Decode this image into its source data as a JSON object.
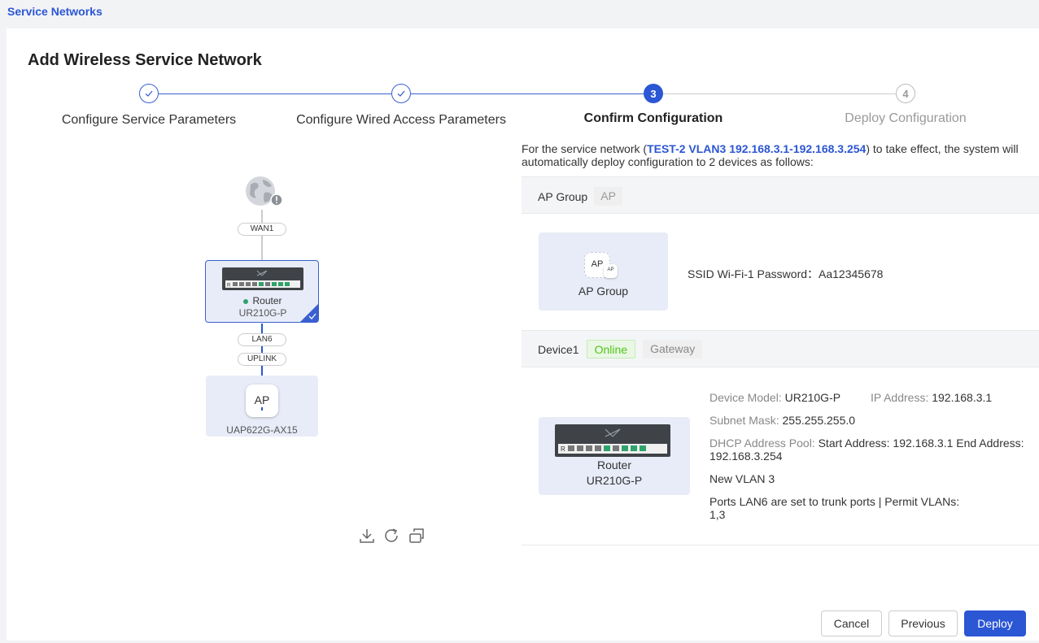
{
  "breadcrumb": "Service Networks",
  "title": "Add Wireless Service Network",
  "steps": [
    {
      "label": "Configure Service Parameters",
      "state": "done"
    },
    {
      "label": "Configure Wired Access Parameters",
      "state": "done"
    },
    {
      "label": "Confirm Configuration",
      "state": "current",
      "number": "3"
    },
    {
      "label": "Deploy Configuration",
      "state": "future",
      "number": "4"
    }
  ],
  "topology": {
    "wan_tag": "WAN1",
    "router_label": "Router",
    "router_model": "UR210G-P",
    "lan_tag": "LAN6",
    "uplink_tag": "UPLINK",
    "ap_icon_text": "AP",
    "ap_model": "UAP622G-AX15",
    "router_ports_text": "R"
  },
  "intro": {
    "prefix": "For the service network (",
    "network": "TEST-2 VLAN3 192.168.3.1-192.168.3.254",
    "suffix": ") to take effect, the system will automatically deploy configuration to 2 devices as follows:"
  },
  "ap_group_section": {
    "header_label": "AP Group",
    "header_tag": "AP",
    "card_label": "AP Group",
    "card_icon_text": "AP",
    "card_icon_small": "AP",
    "ssid_text": "SSID Wi-Fi-1 Password：Aa12345678"
  },
  "device_section": {
    "header_label": "Device1",
    "status_tag": "Online",
    "role_tag": "Gateway",
    "card_label": "Router",
    "card_model": "UR210G-P",
    "model_key": "Device Model:",
    "model_val": "UR210G-P",
    "ip_key": "IP Address:",
    "ip_val": "192.168.3.1",
    "mask_key": "Subnet Mask:",
    "mask_val": "255.255.255.0",
    "dhcp_key": "DHCP Address Pool:",
    "dhcp_val": "Start Address: 192.168.3.1 End Address: 192.168.3.254",
    "vlan_text": "New VLAN 3",
    "ports_text": "Ports LAN6 are set to trunk ports | Permit VLANs: 1,3"
  },
  "buttons": {
    "cancel": "Cancel",
    "previous": "Previous",
    "deploy": "Deploy"
  },
  "colors": {
    "accent": "#2b56d4",
    "online": "#52c41a",
    "card_bg": "#e8ecf8"
  }
}
